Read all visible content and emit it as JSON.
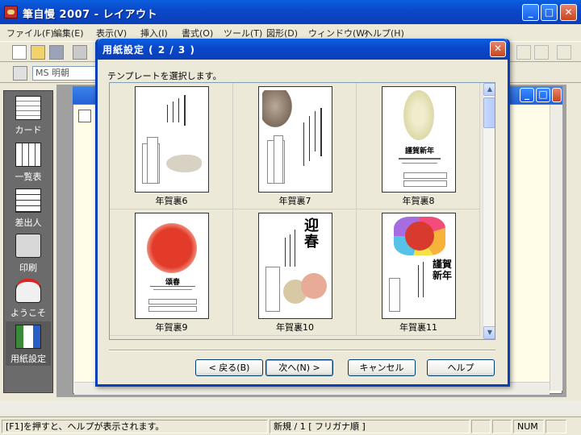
{
  "window": {
    "title": "筆自慢 2007 - レイアウト",
    "min_glyph": "_",
    "max_glyph": "□",
    "close_glyph": "✕"
  },
  "menu": [
    "ファイル(F)",
    "編集(E)",
    "表示(V)",
    "挿入(I)",
    "書式(O)",
    "ツール(T)",
    "図形(D)",
    "ウィンドウ(W)",
    "ヘルプ(H)"
  ],
  "toolbar": {
    "font_name": "MS 明朝"
  },
  "sidebar": {
    "items": [
      {
        "label": "カード",
        "icon": "card-icon"
      },
      {
        "label": "一覧表",
        "icon": "list-table-icon"
      },
      {
        "label": "差出人",
        "icon": "sender-icon"
      },
      {
        "label": "印刷",
        "icon": "printer-icon"
      },
      {
        "label": "ようこそ",
        "icon": "welcome-icon"
      },
      {
        "label": "用紙設定",
        "icon": "paper-setup-icon"
      }
    ]
  },
  "dialog": {
    "title": "用紙設定 ( 2 / 3 )",
    "close_glyph": "✕",
    "prompt": "テンプレートを選択します。",
    "templates": [
      {
        "name": "年賀裏6"
      },
      {
        "name": "年賀裏7"
      },
      {
        "name": "年賀裏8"
      },
      {
        "name": "年賀裏9"
      },
      {
        "name": "年賀裏10"
      },
      {
        "name": "年賀裏11"
      }
    ],
    "card_text": {
      "t8": "謹賀新年",
      "t9": "頌春",
      "t10": "迎春",
      "t11": "謹賀新年"
    },
    "buttons": {
      "back": "< 戻る(B)",
      "next": "次へ(N) >",
      "cancel": "キャンセル",
      "help": "ヘルプ"
    },
    "scroll_up": "▲",
    "scroll_down": "▼"
  },
  "status": {
    "hint": "[F1]を押すと、ヘルプが表示されます。",
    "page": "新規 / 1 [ フリガナ順 ]",
    "num": "NUM"
  },
  "colors": {
    "titlebar": "#0a47c8",
    "close": "#c8451f",
    "sidepanel": "#6b6b6b"
  }
}
